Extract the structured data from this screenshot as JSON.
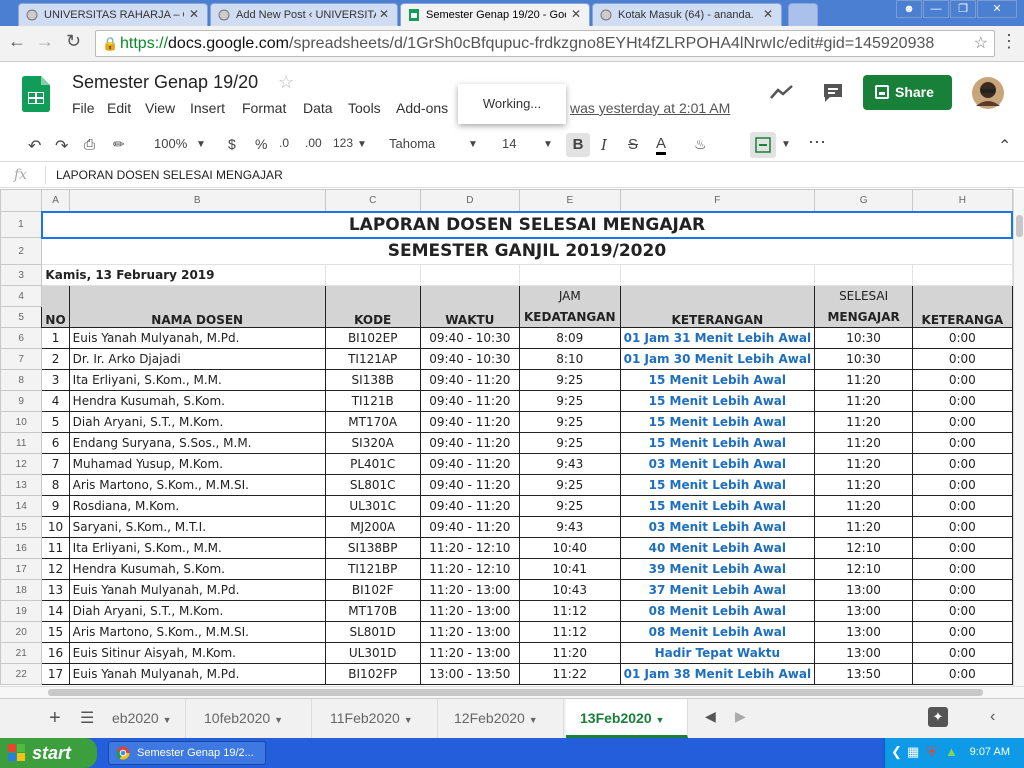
{
  "browser": {
    "tabs": [
      {
        "title": "UNIVERSITAS RAHARJA – Cl",
        "active": false
      },
      {
        "title": "Add New Post ‹ UNIVERSITA",
        "active": false
      },
      {
        "title": "Semester Genap 19/20 - Goo",
        "active": true
      },
      {
        "title": "Kotak Masuk (64) - ananda.",
        "active": false
      }
    ],
    "close_glyph": "✕",
    "url_scheme": "https://",
    "url_domain": "docs.google.com",
    "url_path": "/spreadsheets/d/1GrSh0cBfqupuc-frdkzgno8EYHt4fZLRPOHA4lNrwIc/edit#gid=145920938"
  },
  "app": {
    "title": "Semester Genap 19/20",
    "menu": [
      "File",
      "Edit",
      "View",
      "Insert",
      "Format",
      "Data",
      "Tools",
      "Add-ons"
    ],
    "last_edit": "was yesterday at 2:01 AM",
    "working": "Working...",
    "share": "Share"
  },
  "toolbar": {
    "zoom": "100%",
    "currency": "$",
    "percent": "%",
    "dec_less": ".0",
    "dec_more": ".00",
    "format_more": "123",
    "font": "Tahoma",
    "font_size": "14",
    "bold": "B",
    "italic": "I",
    "strike": "S",
    "text_color": "A"
  },
  "formula": {
    "label": "fx",
    "value": "LAPORAN DOSEN SELESAI MENGAJAR"
  },
  "columns": [
    "A",
    "B",
    "C",
    "D",
    "E",
    "F",
    "G",
    "H"
  ],
  "sheet": {
    "title": "LAPORAN DOSEN SELESAI MENGAJAR",
    "subtitle": "SEMESTER GANJIL 2019/2020",
    "date": "Kamis, 13 February 2019",
    "headers": {
      "no": "NO",
      "nama": "NAMA DOSEN",
      "kode": "KODE",
      "waktu": "WAKTU",
      "jam_top": "JAM",
      "jam_bottom": "KEDATANGAN",
      "keterangan": "KETERANGAN",
      "selesai_top": "SELESAI",
      "selesai_bottom": "MENGAJAR",
      "keterangan2": "KETERANGA"
    },
    "rows": [
      {
        "r": "6",
        "no": "1",
        "nama": "Euis Yanah Mulyanah, M.Pd.",
        "kode": "BI102EP",
        "waktu": "09:40 - 10:30",
        "jam": "8:09",
        "ket": "01 Jam 31 Menit Lebih Awal",
        "selesai": "10:30",
        "ket2": "0:00"
      },
      {
        "r": "7",
        "no": "2",
        "nama": "Dr. Ir. Arko Djajadi",
        "kode": "TI121AP",
        "waktu": "09:40 - 10:30",
        "jam": "8:10",
        "ket": "01 Jam 30 Menit Lebih Awal",
        "selesai": "10:30",
        "ket2": "0:00"
      },
      {
        "r": "8",
        "no": "3",
        "nama": "Ita Erliyani, S.Kom., M.M.",
        "kode": "SI138B",
        "waktu": "09:40 - 11:20",
        "jam": "9:25",
        "ket": "15 Menit Lebih Awal",
        "selesai": "11:20",
        "ket2": "0:00"
      },
      {
        "r": "9",
        "no": "4",
        "nama": "Hendra Kusumah, S.Kom.",
        "kode": "TI121B",
        "waktu": "09:40 - 11:20",
        "jam": "9:25",
        "ket": "15 Menit Lebih Awal",
        "selesai": "11:20",
        "ket2": "0:00"
      },
      {
        "r": "10",
        "no": "5",
        "nama": "Diah Aryani, S.T., M.Kom.",
        "kode": "MT170A",
        "waktu": "09:40 - 11:20",
        "jam": "9:25",
        "ket": "15 Menit Lebih Awal",
        "selesai": "11:20",
        "ket2": "0:00"
      },
      {
        "r": "11",
        "no": "6",
        "nama": "Endang Suryana, S.Sos., M.M.",
        "kode": "SI320A",
        "waktu": "09:40 - 11:20",
        "jam": "9:25",
        "ket": "15 Menit Lebih Awal",
        "selesai": "11:20",
        "ket2": "0:00"
      },
      {
        "r": "12",
        "no": "7",
        "nama": "Muhamad Yusup, M.Kom.",
        "kode": "PL401C",
        "waktu": "09:40 - 11:20",
        "jam": "9:43",
        "ket": "03 Menit Lebih Awal",
        "selesai": "11:20",
        "ket2": "0:00"
      },
      {
        "r": "13",
        "no": "8",
        "nama": "Aris Martono, S.Kom., M.M.SI.",
        "kode": "SL801C",
        "waktu": "09:40 - 11:20",
        "jam": "9:25",
        "ket": "15 Menit Lebih Awal",
        "selesai": "11:20",
        "ket2": "0:00"
      },
      {
        "r": "14",
        "no": "9",
        "nama": "Rosdiana, M.Kom.",
        "kode": "UL301C",
        "waktu": "09:40 - 11:20",
        "jam": "9:25",
        "ket": "15 Menit Lebih Awal",
        "selesai": "11:20",
        "ket2": "0:00"
      },
      {
        "r": "15",
        "no": "10",
        "nama": "Saryani, S.Kom., M.T.I.",
        "kode": "MJ200A",
        "waktu": "09:40 - 11:20",
        "jam": "9:43",
        "ket": "03 Menit Lebih Awal",
        "selesai": "11:20",
        "ket2": "0:00"
      },
      {
        "r": "16",
        "no": "11",
        "nama": "Ita Erliyani, S.Kom., M.M.",
        "kode": "SI138BP",
        "waktu": "11:20 - 12:10",
        "jam": "10:40",
        "ket": "40 Menit Lebih Awal",
        "selesai": "12:10",
        "ket2": "0:00"
      },
      {
        "r": "17",
        "no": "12",
        "nama": "Hendra Kusumah, S.Kom.",
        "kode": "TI121BP",
        "waktu": "11:20 - 12:10",
        "jam": "10:41",
        "ket": "39 Menit Lebih Awal",
        "selesai": "12:10",
        "ket2": "0:00"
      },
      {
        "r": "18",
        "no": "13",
        "nama": "Euis Yanah Mulyanah, M.Pd.",
        "kode": "BI102F",
        "waktu": "11:20 - 13:00",
        "jam": "10:43",
        "ket": "37 Menit Lebih Awal",
        "selesai": "13:00",
        "ket2": "0:00"
      },
      {
        "r": "19",
        "no": "14",
        "nama": "Diah Aryani, S.T., M.Kom.",
        "kode": "MT170B",
        "waktu": "11:20 - 13:00",
        "jam": "11:12",
        "ket": "08 Menit Lebih Awal",
        "selesai": "13:00",
        "ket2": "0:00"
      },
      {
        "r": "20",
        "no": "15",
        "nama": "Aris Martono, S.Kom., M.M.SI.",
        "kode": "SL801D",
        "waktu": "11:20 - 13:00",
        "jam": "11:12",
        "ket": "08 Menit Lebih Awal",
        "selesai": "13:00",
        "ket2": "0:00"
      },
      {
        "r": "21",
        "no": "16",
        "nama": "Euis Sitinur Aisyah, M.Kom.",
        "kode": "UL301D",
        "waktu": "11:20 - 13:00",
        "jam": "11:20",
        "ket": "Hadir Tepat Waktu",
        "selesai": "13:00",
        "ket2": "0:00"
      },
      {
        "r": "22",
        "no": "17",
        "nama": "Euis Yanah Mulyanah, M.Pd.",
        "kode": "BI102FP",
        "waktu": "13:00 - 13:50",
        "jam": "11:22",
        "ket": "01 Jam 38 Menit Lebih Awal",
        "selesai": "13:50",
        "ket2": "0:00"
      }
    ]
  },
  "sheet_tabs": [
    "eb2020",
    "10feb2020",
    "11Feb2020",
    "12Feb2020",
    "13Feb2020"
  ],
  "taskbar": {
    "start": "start",
    "item": "Semester Genap 19/2...",
    "clock": "9:07 AM"
  },
  "colors": {
    "accent_green": "#188038",
    "link_blue": "#1f6fbf",
    "chrome_blue": "#4a7fd2"
  }
}
